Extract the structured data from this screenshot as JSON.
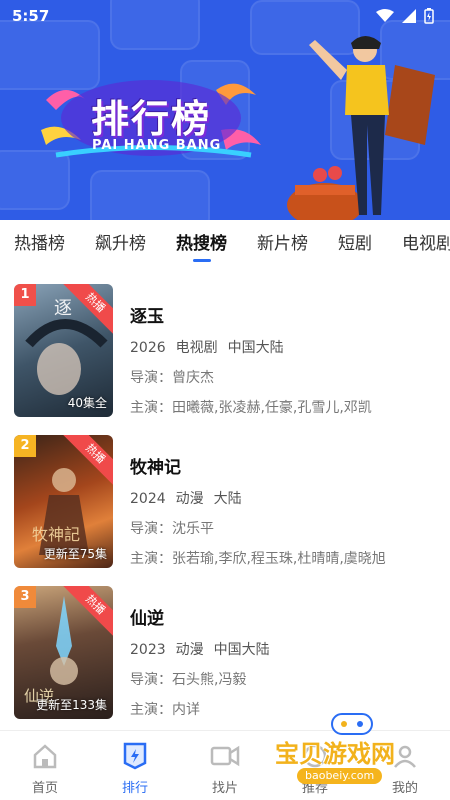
{
  "status_bar": {
    "time": "5:57"
  },
  "hero": {
    "title": "排行榜",
    "subtitle": "PAI HANG BANG"
  },
  "tabs": [
    {
      "label": "热播榜"
    },
    {
      "label": "飙升榜"
    },
    {
      "label": "热搜榜"
    },
    {
      "label": "新片榜"
    },
    {
      "label": "短剧"
    },
    {
      "label": "电视剧"
    }
  ],
  "active_tab": "热搜榜",
  "items": [
    {
      "rank": "1",
      "badge": "热播",
      "episode": "40集全",
      "title": "逐玉",
      "year": "2026",
      "category": "电视剧",
      "region": "中国大陆",
      "director": "导演：曾庆杰",
      "cast": "主演：田曦薇,张凌赫,任豪,孔雪儿,邓凯",
      "rank_color": "#f0504a"
    },
    {
      "rank": "2",
      "badge": "热播",
      "episode": "更新至75集",
      "title": "牧神记",
      "year": "2024",
      "category": "动漫",
      "region": "大陆",
      "director": "导演：沈乐平",
      "cast": "主演：张若瑜,李欣,程玉珠,杜晴晴,虞晓旭",
      "rank_color": "#f6b423"
    },
    {
      "rank": "3",
      "badge": "热播",
      "episode": "更新至133集",
      "title": "仙逆",
      "year": "2023",
      "category": "动漫",
      "region": "中国大陆",
      "director": "导演：石头熊,冯毅",
      "cast": "主演：内详",
      "rank_color": "#f08a3a"
    }
  ],
  "bottom_nav": [
    {
      "label": "首页",
      "icon": "home-icon"
    },
    {
      "label": "排行",
      "icon": "ranking-icon"
    },
    {
      "label": "找片",
      "icon": "video-camera-icon"
    },
    {
      "label": "推荐",
      "icon": "recommend-icon"
    },
    {
      "label": "我的",
      "icon": "profile-icon"
    }
  ],
  "watermark": {
    "text": "宝贝游戏网",
    "url": "baobeiy.com"
  },
  "colors": {
    "hero_bg": "#2f5ce6",
    "accent": "#2a6df4",
    "badge_red": "#f04a4a"
  }
}
